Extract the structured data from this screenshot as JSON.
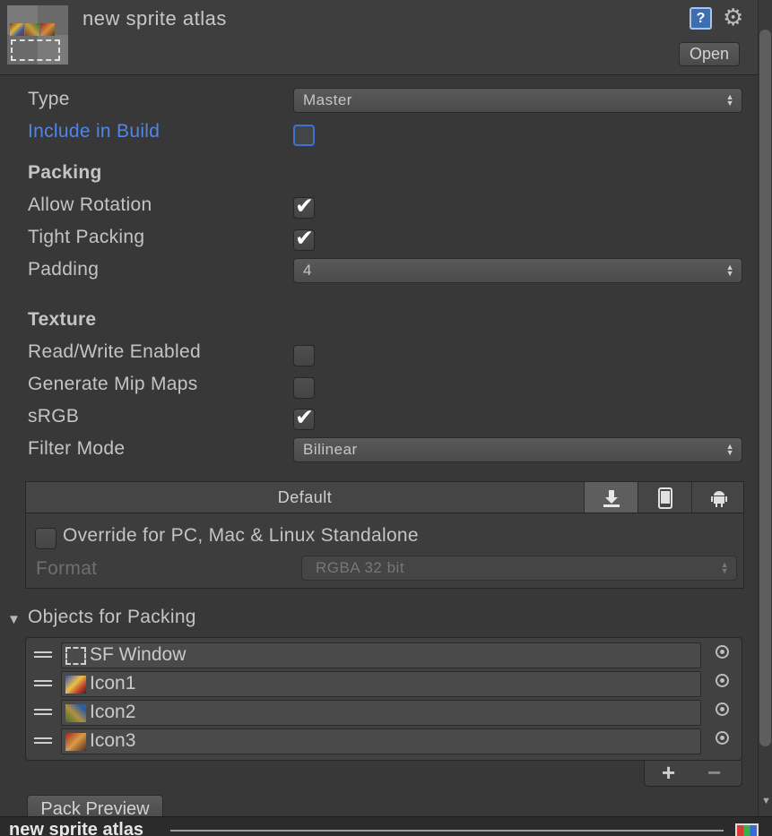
{
  "header": {
    "title": "new sprite atlas",
    "open_label": "Open",
    "help_icon": "help-book-icon",
    "settings_icon": "gear-icon"
  },
  "fields": {
    "type_label": "Type",
    "type_value": "Master",
    "include_label": "Include in Build",
    "include_checked": false,
    "packing_heading": "Packing",
    "allow_rotation_label": "Allow Rotation",
    "allow_rotation_checked": true,
    "tight_packing_label": "Tight Packing",
    "tight_packing_checked": true,
    "padding_label": "Padding",
    "padding_value": "4",
    "texture_heading": "Texture",
    "read_write_label": "Read/Write Enabled",
    "read_write_checked": false,
    "mipmaps_label": "Generate Mip Maps",
    "mipmaps_checked": false,
    "srgb_label": "sRGB",
    "srgb_checked": true,
    "filter_label": "Filter Mode",
    "filter_value": "Bilinear"
  },
  "platforms": {
    "default_tab": "Default",
    "tab_icons": [
      "download-icon",
      "mobile-icon",
      "android-icon"
    ],
    "override_label": "Override for PC, Mac & Linux Standalone",
    "override_checked": false,
    "format_label": "Format",
    "format_value": "RGBA 32 bit"
  },
  "objects": {
    "heading": "Objects for Packing",
    "items": [
      {
        "name": "SF Window"
      },
      {
        "name": "Icon1"
      },
      {
        "name": "Icon2"
      },
      {
        "name": "Icon3"
      }
    ],
    "add_label": "+",
    "remove_label": "−"
  },
  "pack_preview_label": "Pack Preview",
  "bottom": {
    "title": "new sprite atlas"
  },
  "colors": {
    "accent_blue": "#4f86e8",
    "panel_bg": "#383838"
  }
}
